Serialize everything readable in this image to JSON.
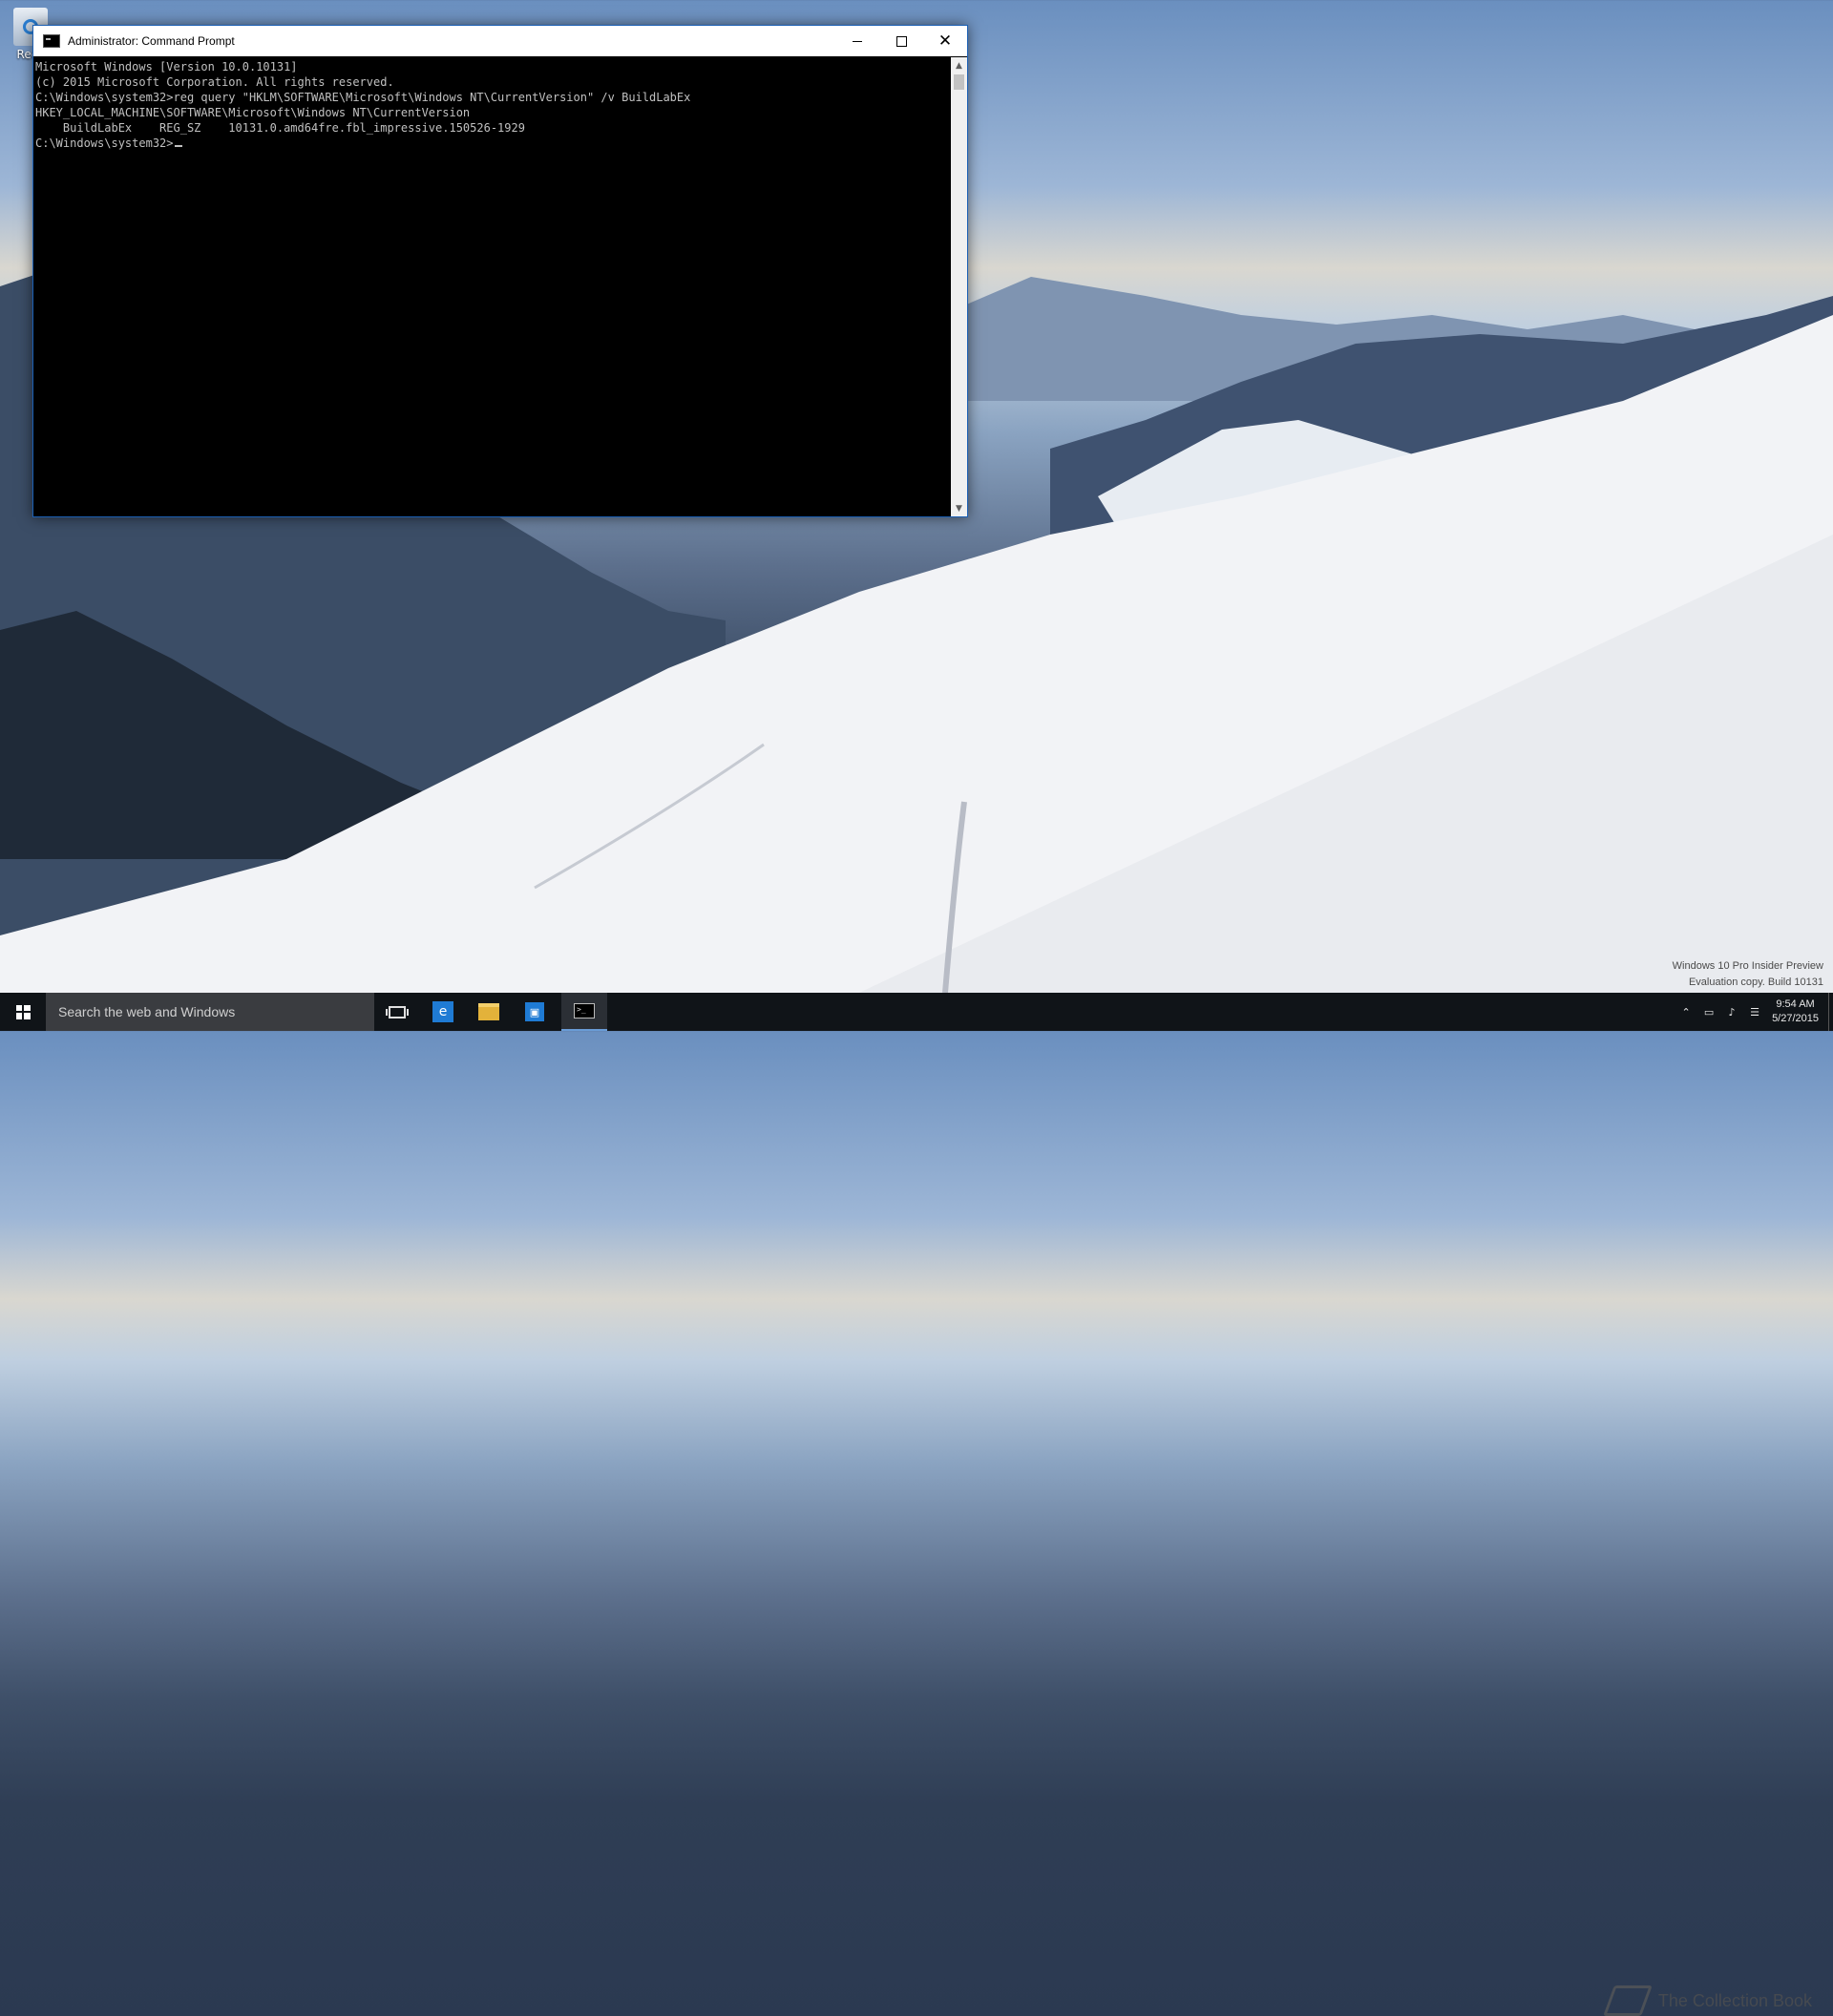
{
  "desktop": {
    "recycle_bin_label": "Recy"
  },
  "window": {
    "title": "Administrator: Command Prompt",
    "minimize_label": "",
    "maximize_label": "",
    "close_label": "✕"
  },
  "console": {
    "lines": [
      "Microsoft Windows [Version 10.0.10131]",
      "(c) 2015 Microsoft Corporation. All rights reserved.",
      "",
      "C:\\Windows\\system32>reg query \"HKLM\\SOFTWARE\\Microsoft\\Windows NT\\CurrentVersion\" /v BuildLabEx",
      "",
      "HKEY_LOCAL_MACHINE\\SOFTWARE\\Microsoft\\Windows NT\\CurrentVersion",
      "    BuildLabEx    REG_SZ    10131.0.amd64fre.fbl_impressive.150526-1929",
      "",
      ""
    ],
    "prompt": "C:\\Windows\\system32>"
  },
  "watermark": {
    "line1": "Windows 10 Pro Insider Preview",
    "line2": "Evaluation copy. Build 10131"
  },
  "brand": {
    "text": "The Collection Book"
  },
  "taskbar": {
    "search_placeholder": "Search the web and Windows",
    "apps": [
      "task-view",
      "edge",
      "file-explorer",
      "store",
      "command-prompt"
    ],
    "active_app": "command-prompt",
    "clock_time": "9:54 AM",
    "clock_date": "5/27/2015"
  },
  "colors": {
    "console_bg": "#000000",
    "console_text": "#c0c0c0",
    "taskbar_bg": "#101418",
    "accent": "#1f7bd4"
  }
}
